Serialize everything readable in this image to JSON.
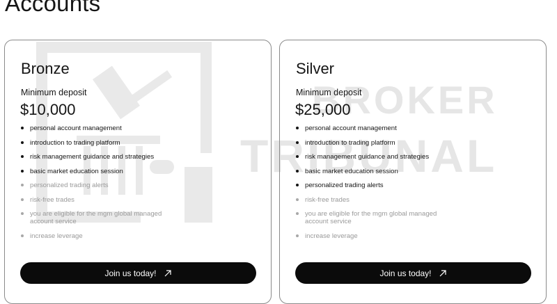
{
  "page": {
    "title": "Accounts"
  },
  "watermark": {
    "lines": [
      "BROKER",
      "TRIBUNAL"
    ]
  },
  "plans": [
    {
      "name": "Bronze",
      "deposit_label": "Minimum deposit",
      "deposit_amount": "$10,000",
      "features": [
        {
          "text": "personal account management",
          "included": true
        },
        {
          "text": "introduction to trading platform",
          "included": true
        },
        {
          "text": "risk management guidance and strategies",
          "included": true
        },
        {
          "text": "basic market education session",
          "included": true
        },
        {
          "text": "personalized trading alerts",
          "included": false
        },
        {
          "text": "risk-free trades",
          "included": false
        },
        {
          "text": "you are eligible for the mgm global managed account service",
          "included": false
        },
        {
          "text": "increase leverage",
          "included": false
        }
      ],
      "cta_label": "Join us today!",
      "cta_icon": "arrow-up-right-icon"
    },
    {
      "name": "Silver",
      "deposit_label": "Minimum deposit",
      "deposit_amount": "$25,000",
      "features": [
        {
          "text": "personal account management",
          "included": true
        },
        {
          "text": "introduction to trading platform",
          "included": true
        },
        {
          "text": "risk management guidance and strategies",
          "included": true
        },
        {
          "text": "basic market education session",
          "included": true
        },
        {
          "text": "personalized trading alerts",
          "included": true
        },
        {
          "text": "risk-free trades",
          "included": false
        },
        {
          "text": "you are eligible for the mgm global managed account service",
          "included": false
        },
        {
          "text": "increase leverage",
          "included": false
        }
      ],
      "cta_label": "Join us today!",
      "cta_icon": "arrow-up-right-icon"
    }
  ],
  "colors": {
    "button_bg": "#0b0b0b",
    "text": "#151515",
    "disabled_text": "#9a9a9a",
    "border": "#8a8a8a",
    "watermark": "#e6e6e6"
  }
}
